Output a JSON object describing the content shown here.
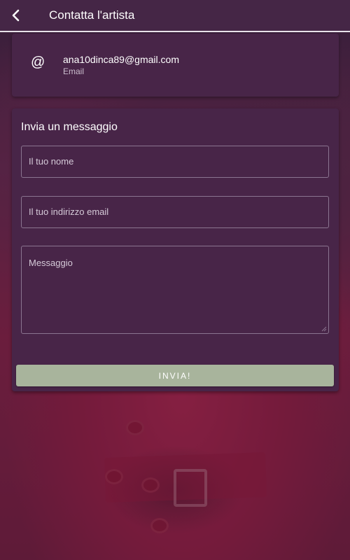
{
  "header": {
    "title": "Contatta l'artista",
    "back_icon": "chevron-left-icon"
  },
  "contact": {
    "icon": "at-sign-icon",
    "icon_glyph": "@",
    "value": "ana10dinca89@gmail.com",
    "label": "Email"
  },
  "form": {
    "title": "Invia un messaggio",
    "name_placeholder": "Il tuo nome",
    "email_placeholder": "Il tuo indirizzo email",
    "message_placeholder": "Messaggio",
    "submit_label": "INVIA!"
  },
  "colors": {
    "header_bg": "#452646",
    "card_bg": "#482548",
    "button_bg": "#a8b49c",
    "field_border": "#8b7590"
  }
}
